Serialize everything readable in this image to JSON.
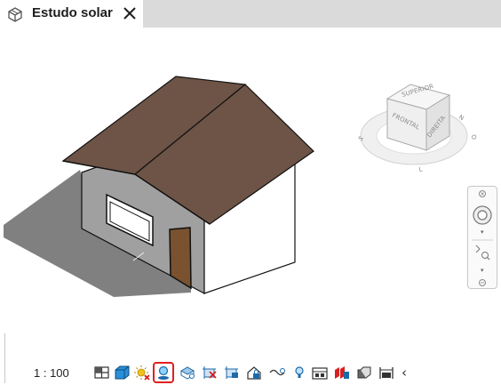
{
  "tab": {
    "title": "Estudo solar",
    "icon": "3d-view-icon",
    "close_icon": "close-icon"
  },
  "viewcube": {
    "faces": [
      "SUPERIOR",
      "FRONTAL",
      "DIREITA"
    ],
    "compass": [
      "N",
      "S",
      "L",
      "O"
    ]
  },
  "status": {
    "scale": "1 : 100",
    "icons": [
      "detail-level-icon",
      "visual-style-icon",
      "sun-path-icon",
      "shadows-icon",
      "crop-view-icon",
      "show-crop-region-icon",
      "unlock-3d-view-icon",
      "temporary-hide-isolate-icon",
      "reveal-hidden-elements-icon",
      "light-bulb-icon",
      "temporary-view-properties-icon",
      "show-analytical-model-icon",
      "highlight-displacement-icon",
      "reveal-constraints-icon",
      "collapse-chevron-icon"
    ],
    "selected_icon": "shadows-icon",
    "accent_color": "#e02020"
  }
}
